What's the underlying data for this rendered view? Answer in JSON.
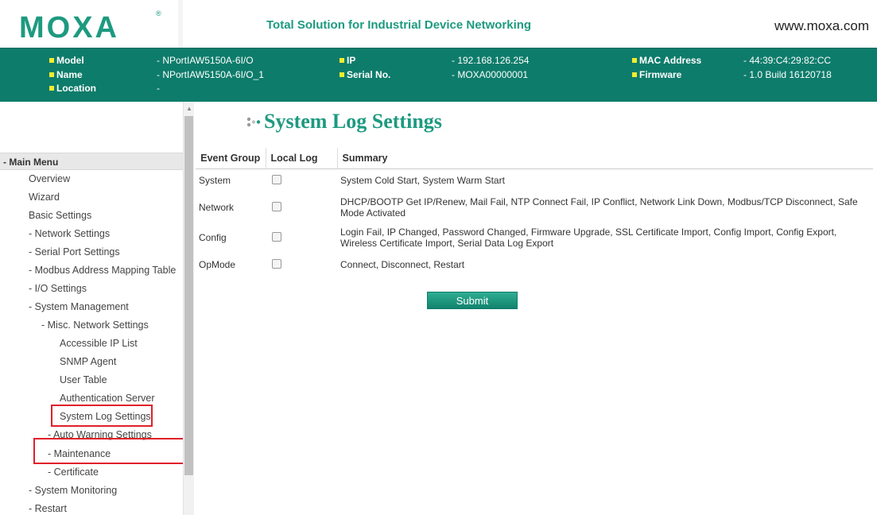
{
  "brand": {
    "logo": "MOXA",
    "reg": "®",
    "tagline": "Total Solution for Industrial Device Networking",
    "website": "www.moxa.com"
  },
  "device_info": {
    "model_key": "Model",
    "model_val": "- NPortIAW5150A-6I/O",
    "name_key": "Name",
    "name_val": "- NPortIAW5150A-6I/O_1",
    "location_key": "Location",
    "location_val": "-",
    "ip_key": "IP",
    "ip_val": "- 192.168.126.254",
    "serial_key": "Serial No.",
    "serial_val": "- MOXA00000001",
    "mac_key": "MAC Address",
    "mac_val": "- 44:39:C4:29:82:CC",
    "firmware_key": "Firmware",
    "firmware_val": "- 1.0 Build 16120718"
  },
  "sidebar": {
    "header": "- Main Menu",
    "items": [
      "Overview",
      "Wizard",
      "Basic Settings",
      "- Network Settings",
      "- Serial Port Settings",
      "- Modbus Address Mapping Table",
      "- I/O Settings",
      "- System Management",
      "- Misc. Network Settings",
      "Accessible IP List",
      "SNMP Agent",
      "User Table",
      "Authentication Server",
      "System Log Settings",
      "- Auto Warning Settings",
      "- Maintenance",
      "- Certificate",
      "- System Monitoring",
      "- Restart"
    ]
  },
  "page": {
    "title": "System Log Settings",
    "submit_label": "Submit"
  },
  "table": {
    "headers": [
      "Event Group",
      "Local Log",
      "Summary"
    ],
    "rows": [
      {
        "group": "System",
        "checked": false,
        "summary": "System Cold Start, System Warm Start"
      },
      {
        "group": "Network",
        "checked": false,
        "summary": "DHCP/BOOTP Get IP/Renew, Mail Fail, NTP Connect Fail, IP Conflict, Network Link Down, Modbus/TCP Disconnect, Safe Mode Activated"
      },
      {
        "group": "Config",
        "checked": false,
        "summary": "Login Fail, IP Changed, Password Changed, Firmware Upgrade, SSL Certificate Import, Config Import, Config Export, Wireless Certificate Import, Serial Data Log Export"
      },
      {
        "group": "OpMode",
        "checked": false,
        "summary": "Connect, Disconnect, Restart"
      }
    ]
  },
  "colors": {
    "brand_green": "#1d9a80",
    "infobar": "#0e7c6b",
    "highlight_red": "#e0202a"
  }
}
